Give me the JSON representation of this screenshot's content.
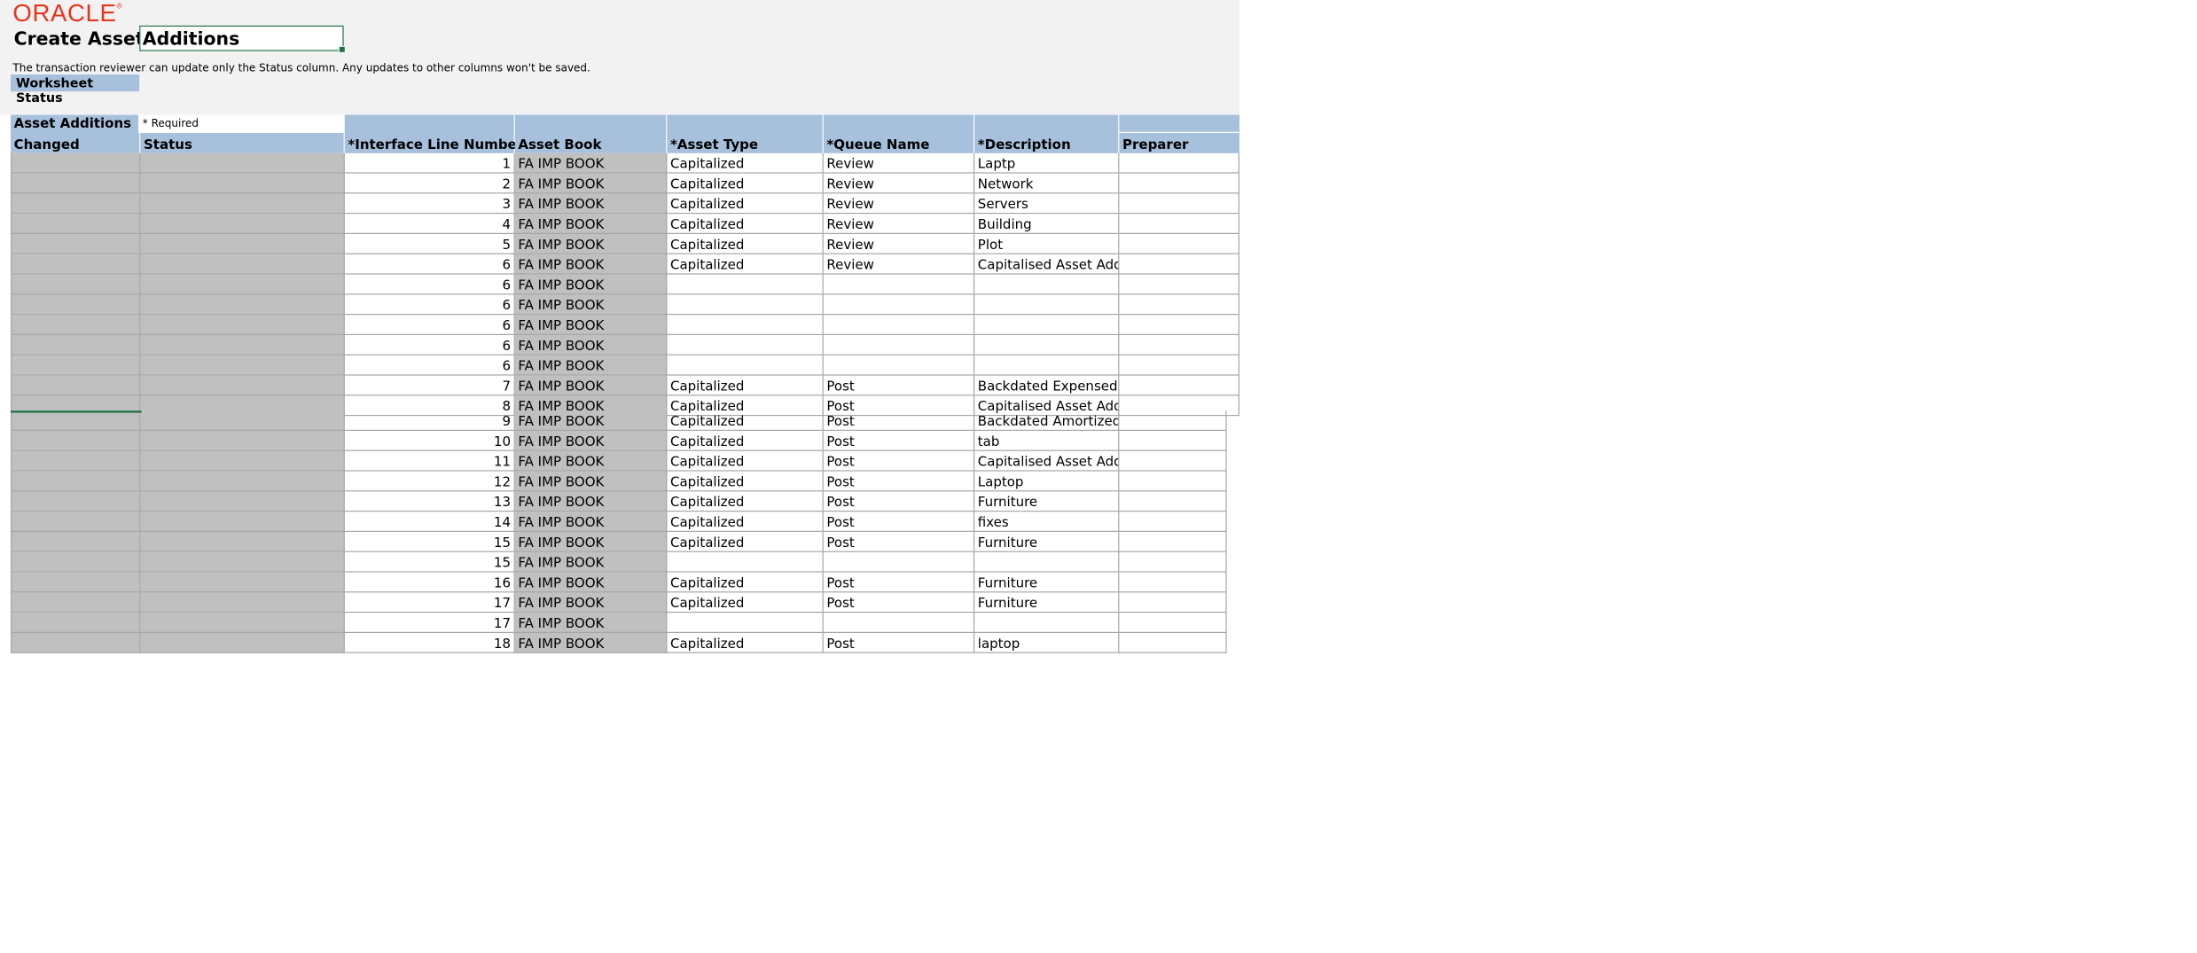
{
  "brand": {
    "logo_text": "ORACLE",
    "logo_mark": "®"
  },
  "header": {
    "title_part1": "Create Asset",
    "title_part2": "Additions",
    "note": "The transaction reviewer can update only the Status column. Any updates to other columns won't be saved.",
    "worksheet_status_label": "Worksheet Status",
    "required_note": "* Required"
  },
  "table": {
    "group_header": "Asset Additions",
    "columns": [
      {
        "key": "changed",
        "label": "Changed"
      },
      {
        "key": "status",
        "label": "Status"
      },
      {
        "key": "line",
        "label": "*Interface Line Number"
      },
      {
        "key": "book",
        "label": "Asset Book"
      },
      {
        "key": "type",
        "label": "*Asset Type"
      },
      {
        "key": "queue",
        "label": "*Queue Name"
      },
      {
        "key": "desc",
        "label": "*Description"
      },
      {
        "key": "preparer",
        "label": "Preparer"
      }
    ],
    "rows": [
      {
        "line": "1",
        "book": "FA IMP BOOK",
        "type": "Capitalized",
        "queue": "Review",
        "desc": "Laptp"
      },
      {
        "line": "2",
        "book": "FA IMP BOOK",
        "type": "Capitalized",
        "queue": "Review",
        "desc": "Network"
      },
      {
        "line": "3",
        "book": "FA IMP BOOK",
        "type": "Capitalized",
        "queue": "Review",
        "desc": "Servers"
      },
      {
        "line": "4",
        "book": "FA IMP BOOK",
        "type": "Capitalized",
        "queue": "Review",
        "desc": "Building"
      },
      {
        "line": "5",
        "book": "FA IMP BOOK",
        "type": "Capitalized",
        "queue": "Review",
        "desc": "Plot"
      },
      {
        "line": "6",
        "book": "FA IMP BOOK",
        "type": "Capitalized",
        "queue": "Review",
        "desc": "Capitalised Asset Additi"
      },
      {
        "line": "6",
        "book": "FA IMP BOOK",
        "type": "",
        "queue": "",
        "desc": ""
      },
      {
        "line": "6",
        "book": "FA IMP BOOK",
        "type": "",
        "queue": "",
        "desc": ""
      },
      {
        "line": "6",
        "book": "FA IMP BOOK",
        "type": "",
        "queue": "",
        "desc": ""
      },
      {
        "line": "6",
        "book": "FA IMP BOOK",
        "type": "",
        "queue": "",
        "desc": ""
      },
      {
        "line": "6",
        "book": "FA IMP BOOK",
        "type": "",
        "queue": "",
        "desc": ""
      },
      {
        "line": "7",
        "book": "FA IMP BOOK",
        "type": "Capitalized",
        "queue": "Post",
        "desc": "Backdated Expensed Ac"
      },
      {
        "line": "8",
        "book": "FA IMP BOOK",
        "type": "Capitalized",
        "queue": "Post",
        "desc": "Capitalised Asset Additi"
      },
      {
        "line": "9",
        "book": "FA IMP BOOK",
        "type": "Capitalized",
        "queue": "Post",
        "desc": "Backdated Amortized Ac"
      },
      {
        "line": "10",
        "book": "FA IMP BOOK",
        "type": "Capitalized",
        "queue": "Post",
        "desc": "tab"
      },
      {
        "line": "11",
        "book": "FA IMP BOOK",
        "type": "Capitalized",
        "queue": "Post",
        "desc": "Capitalised Asset Additi"
      },
      {
        "line": "12",
        "book": "FA IMP BOOK",
        "type": "Capitalized",
        "queue": "Post",
        "desc": "Laptop"
      },
      {
        "line": "13",
        "book": "FA IMP BOOK",
        "type": "Capitalized",
        "queue": "Post",
        "desc": "Furniture"
      },
      {
        "line": "14",
        "book": "FA IMP BOOK",
        "type": "Capitalized",
        "queue": "Post",
        "desc": "fixes"
      },
      {
        "line": "15",
        "book": "FA IMP BOOK",
        "type": "Capitalized",
        "queue": "Post",
        "desc": "Furniture"
      },
      {
        "line": "15",
        "book": "FA IMP BOOK",
        "type": "",
        "queue": "",
        "desc": ""
      },
      {
        "line": "16",
        "book": "FA IMP BOOK",
        "type": "Capitalized",
        "queue": "Post",
        "desc": "Furniture"
      },
      {
        "line": "17",
        "book": "FA IMP BOOK",
        "type": "Capitalized",
        "queue": "Post",
        "desc": "Furniture"
      },
      {
        "line": "17",
        "book": "FA IMP BOOK",
        "type": "",
        "queue": "",
        "desc": ""
      },
      {
        "line": "18",
        "book": "FA IMP BOOK",
        "type": "Capitalized",
        "queue": "Post",
        "desc": "laptop"
      }
    ]
  }
}
